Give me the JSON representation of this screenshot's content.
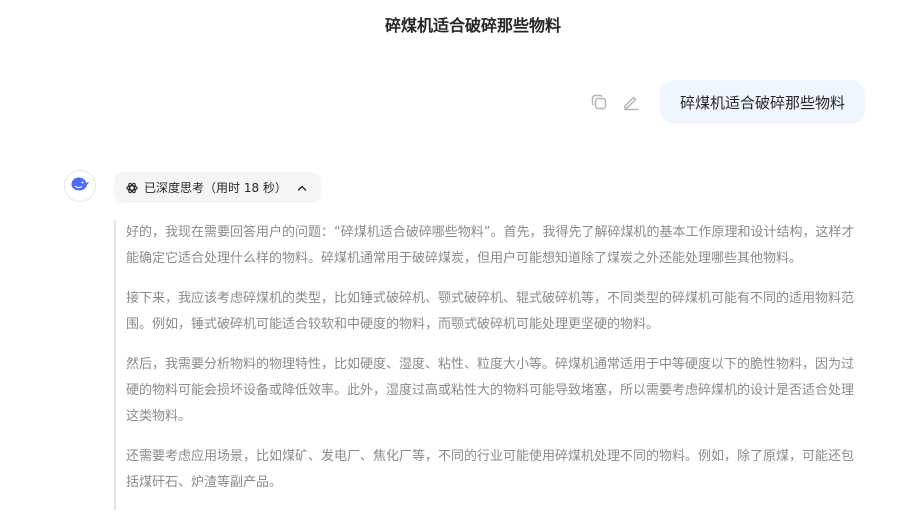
{
  "header": {
    "title": "碎煤机适合破碎那些物料"
  },
  "user_message": {
    "text": "碎煤机适合破碎那些物料"
  },
  "actions": {
    "copy_icon": "copy-icon",
    "edit_icon": "edit-icon"
  },
  "assistant": {
    "avatar_icon": "whale-icon",
    "think_label": "已深度思考（用时 18 秒）",
    "paragraphs": [
      "好的，我现在需要回答用户的问题：“碎煤机适合破碎哪些物料”。首先，我得先了解碎煤机的基本工作原理和设计结构，这样才能确定它适合处理什么样的物料。碎煤机通常用于破碎煤炭，但用户可能想知道除了煤炭之外还能处理哪些其他物料。",
      "接下来，我应该考虑碎煤机的类型，比如锤式破碎机、颚式破碎机、辊式破碎机等，不同类型的碎煤机可能有不同的适用物料范围。例如，锤式破碎机可能适合较软和中硬度的物料，而颚式破碎机可能处理更坚硬的物料。",
      "然后，我需要分析物料的物理特性，比如硬度、湿度、粘性、粒度大小等。碎煤机通常适用于中等硬度以下的脆性物料，因为过硬的物料可能会损坏设备或降低效率。此外，湿度过高或粘性大的物料可能导致堵塞，所以需要考虑碎煤机的设计是否适合处理这类物料。",
      "还需要考虑应用场景，比如煤矿、发电厂、焦化厂等，不同的行业可能使用碎煤机处理不同的物料。例如，除了原煤，可能还包括煤矸石、炉渣等副产品。"
    ]
  },
  "colors": {
    "accent": "#4d6bfe",
    "bubble": "#eff6ff",
    "muted_text": "#8b8b8b"
  }
}
